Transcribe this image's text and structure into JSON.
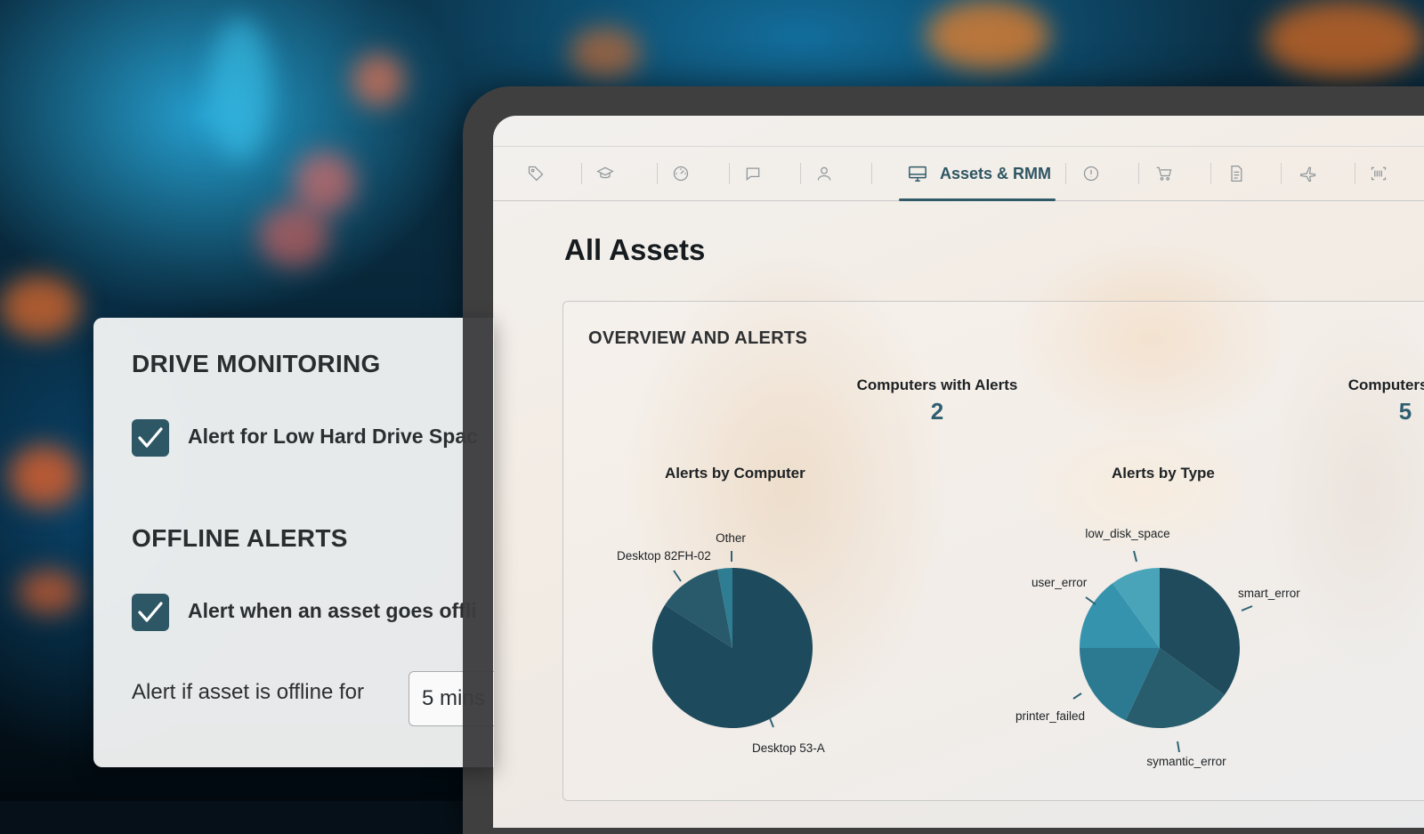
{
  "nav": {
    "items": [
      {
        "icon": "tag-icon"
      },
      {
        "icon": "graduation-cap-icon"
      },
      {
        "icon": "dashboard-gauge-icon"
      },
      {
        "icon": "chat-bubble-icon"
      },
      {
        "icon": "user-icon"
      },
      {
        "icon": "monitor-icon",
        "label": "Assets & RMM",
        "active": true
      },
      {
        "icon": "alert-circle-icon"
      },
      {
        "icon": "shopping-cart-icon"
      },
      {
        "icon": "document-icon"
      },
      {
        "icon": "plane-icon"
      },
      {
        "icon": "barcode-icon"
      }
    ],
    "active_label": "Assets & RMM"
  },
  "page": {
    "title": "All Assets"
  },
  "overview": {
    "title": "OVERVIEW AND ALERTS",
    "stats": [
      {
        "label": "Computers with Alerts",
        "value": "2"
      },
      {
        "label": "Computers with",
        "value": "5"
      }
    ]
  },
  "chart_data": [
    {
      "type": "pie",
      "title": "Alerts by Computer",
      "slices": [
        {
          "label": "Desktop 53-A",
          "value": 84,
          "color": "#1d4a5c"
        },
        {
          "label": "Desktop 82FH-02",
          "value": 13,
          "color": "#285a6b"
        },
        {
          "label": "Other",
          "value": 3,
          "color": "#2f7d93"
        }
      ]
    },
    {
      "type": "pie",
      "title": "Alerts by Type",
      "slices": [
        {
          "label": "smart_error",
          "value": 35,
          "color": "#1f4b5c"
        },
        {
          "label": "symantic_error",
          "value": 22,
          "color": "#285d6e"
        },
        {
          "label": "printer_failed",
          "value": 18,
          "color": "#2c7a91"
        },
        {
          "label": "user_error",
          "value": 15,
          "color": "#3593ad"
        },
        {
          "label": "low_disk_space",
          "value": 10,
          "color": "#4aa4b9"
        }
      ]
    }
  ],
  "settings": {
    "drive_heading": "DRIVE MONITORING",
    "drive_check_label": "Alert for Low Hard Drive Spac",
    "drive_checked": true,
    "offline_heading": "OFFLINE ALERTS",
    "offline_check_label": "Alert when an asset goes offli",
    "offline_checked": true,
    "offline_for_label": "Alert if asset is offline for",
    "offline_for_value": "5 mins"
  },
  "colors": {
    "accent": "#2e5766",
    "active_tab": "#2e5563",
    "stat_value": "#2e5f70"
  }
}
